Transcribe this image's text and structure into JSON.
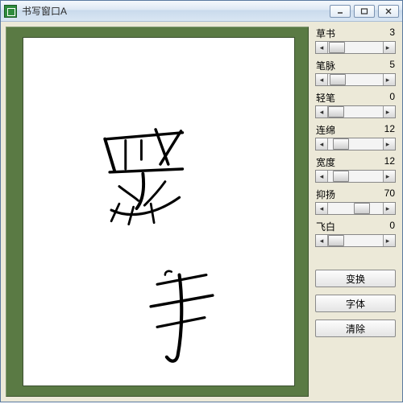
{
  "window": {
    "title": "书写窗口A"
  },
  "sliders": [
    {
      "label": "草书",
      "value": 3,
      "max": 100
    },
    {
      "label": "笔脉",
      "value": 5,
      "max": 100
    },
    {
      "label": "轻笔",
      "value": 0,
      "max": 100
    },
    {
      "label": "连绵",
      "value": 12,
      "max": 100
    },
    {
      "label": "宽度",
      "value": 12,
      "max": 100
    },
    {
      "label": "抑扬",
      "value": 70,
      "max": 100
    },
    {
      "label": "飞白",
      "value": 0,
      "max": 100
    }
  ],
  "buttons": {
    "convert": "变换",
    "font": "字体",
    "clear": "清除"
  },
  "canvas_content": "handwritten-chinese-calligraphy"
}
